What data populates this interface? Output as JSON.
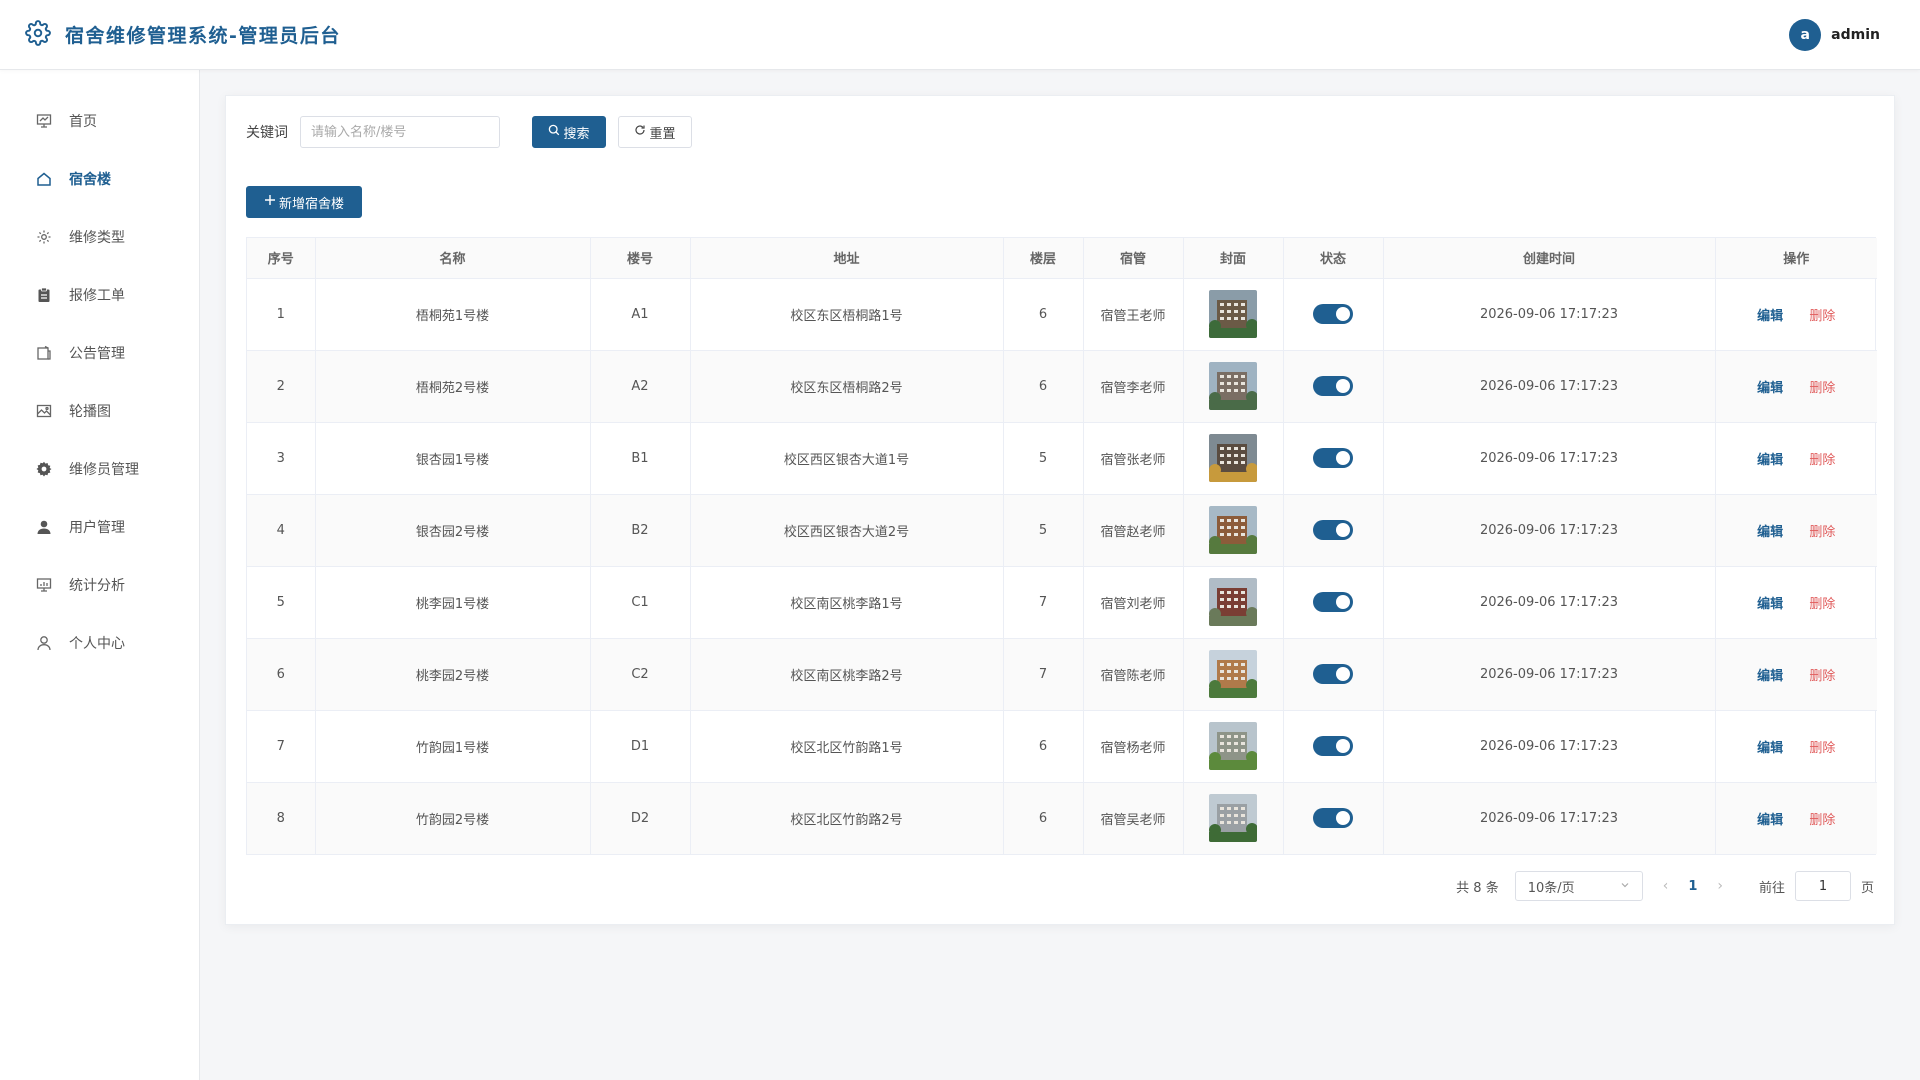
{
  "header": {
    "title": "宿舍维修管理系统-管理员后台",
    "logo_icon": "gear-icon",
    "user": {
      "avatar_letter": "a",
      "name": "admin"
    }
  },
  "sidebar": {
    "items": [
      {
        "label": "首页",
        "icon": "presentation-icon",
        "active": false
      },
      {
        "label": "宿舍楼",
        "icon": "home-icon",
        "active": true
      },
      {
        "label": "维修类型",
        "icon": "settings-icon",
        "active": false
      },
      {
        "label": "报修工单",
        "icon": "clipboard-icon",
        "active": false
      },
      {
        "label": "公告管理",
        "icon": "notice-icon",
        "active": false
      },
      {
        "label": "轮播图",
        "icon": "picture-icon",
        "active": false
      },
      {
        "label": "维修员管理",
        "icon": "cog-icon",
        "active": false
      },
      {
        "label": "用户管理",
        "icon": "user-filled-icon",
        "active": false
      },
      {
        "label": "统计分析",
        "icon": "chart-board-icon",
        "active": false
      },
      {
        "label": "个人中心",
        "icon": "user-outline-icon",
        "active": false
      }
    ]
  },
  "search": {
    "label": "关键词",
    "placeholder": "请输入名称/楼号",
    "value": "",
    "search_button": "搜索",
    "reset_button": "重置"
  },
  "toolbar": {
    "add_button": "新增宿舍楼"
  },
  "table": {
    "columns": [
      "序号",
      "名称",
      "楼号",
      "地址",
      "楼层",
      "宿管",
      "封面",
      "状态",
      "创建时间",
      "操作"
    ],
    "rows": [
      {
        "no": "1",
        "name": "梧桐苑1号楼",
        "code": "A1",
        "address": "校区东区梧桐路1号",
        "floors": "6",
        "manager": "宿管王老师",
        "enabled": true,
        "created": "2026-09-06 17:17:23"
      },
      {
        "no": "2",
        "name": "梧桐苑2号楼",
        "code": "A2",
        "address": "校区东区梧桐路2号",
        "floors": "6",
        "manager": "宿管李老师",
        "enabled": true,
        "created": "2026-09-06 17:17:23"
      },
      {
        "no": "3",
        "name": "银杏园1号楼",
        "code": "B1",
        "address": "校区西区银杏大道1号",
        "floors": "5",
        "manager": "宿管张老师",
        "enabled": true,
        "created": "2026-09-06 17:17:23"
      },
      {
        "no": "4",
        "name": "银杏园2号楼",
        "code": "B2",
        "address": "校区西区银杏大道2号",
        "floors": "5",
        "manager": "宿管赵老师",
        "enabled": true,
        "created": "2026-09-06 17:17:23"
      },
      {
        "no": "5",
        "name": "桃李园1号楼",
        "code": "C1",
        "address": "校区南区桃李路1号",
        "floors": "7",
        "manager": "宿管刘老师",
        "enabled": true,
        "created": "2026-09-06 17:17:23"
      },
      {
        "no": "6",
        "name": "桃李园2号楼",
        "code": "C2",
        "address": "校区南区桃李路2号",
        "floors": "7",
        "manager": "宿管陈老师",
        "enabled": true,
        "created": "2026-09-06 17:17:23"
      },
      {
        "no": "7",
        "name": "竹韵园1号楼",
        "code": "D1",
        "address": "校区北区竹韵路1号",
        "floors": "6",
        "manager": "宿管杨老师",
        "enabled": true,
        "created": "2026-09-06 17:17:23"
      },
      {
        "no": "8",
        "name": "竹韵园2号楼",
        "code": "D2",
        "address": "校区北区竹韵路2号",
        "floors": "6",
        "manager": "宿管吴老师",
        "enabled": true,
        "created": "2026-09-06 17:17:23"
      }
    ],
    "edit_label": "编辑",
    "delete_label": "删除"
  },
  "pagination": {
    "total_text": "共 8 条",
    "page_size": "10条/页",
    "current_page": "1",
    "goto_label": "前往",
    "goto_value": "1",
    "page_suffix": "页"
  },
  "colors": {
    "primary": "#1f5f91",
    "danger": "#e05a5a",
    "background": "#f5f6f8"
  }
}
